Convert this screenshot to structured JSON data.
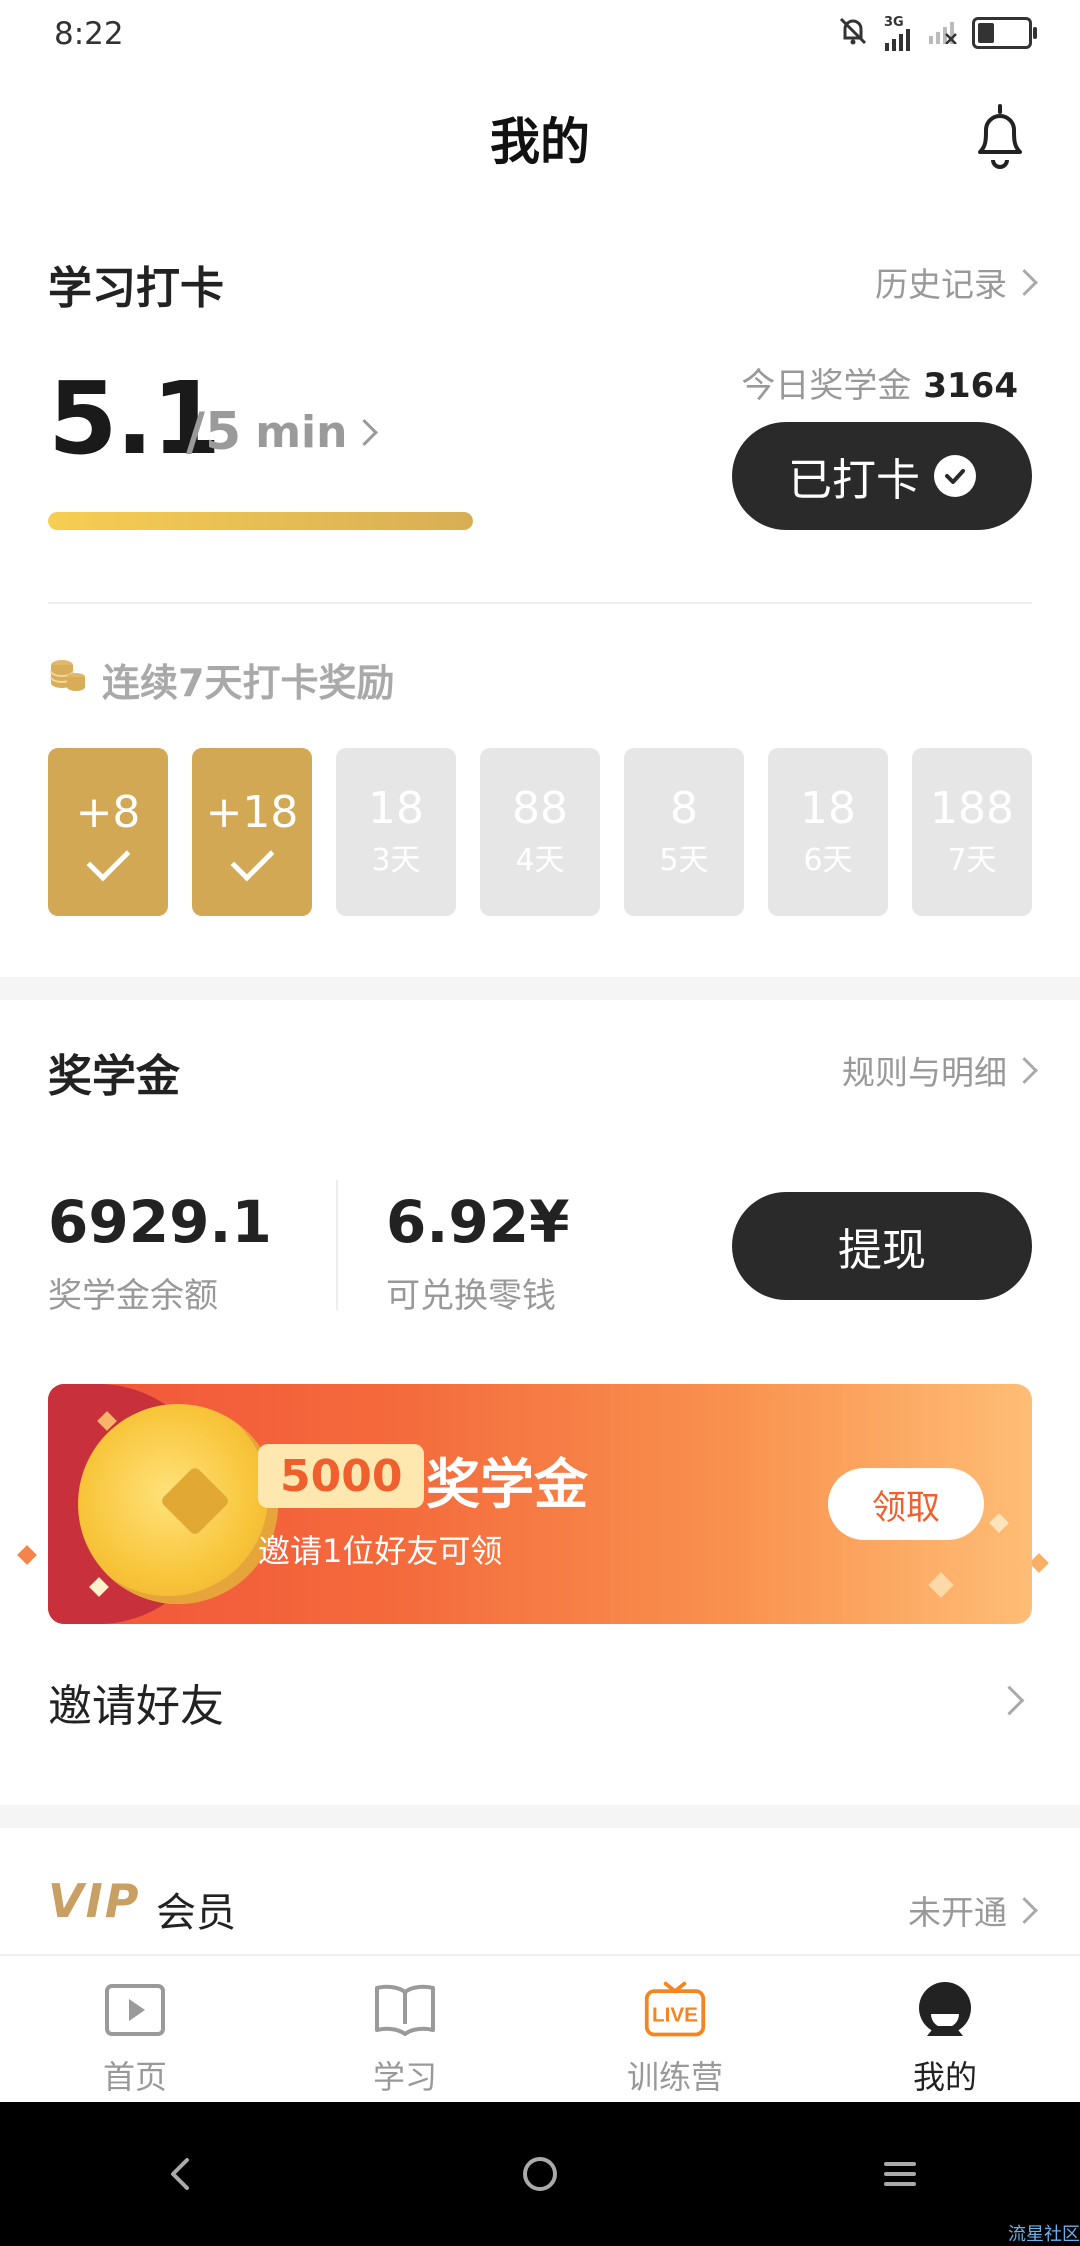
{
  "status_bar": {
    "time": "8:22",
    "network": "3G"
  },
  "header": {
    "title": "我的"
  },
  "checkin": {
    "title": "学习打卡",
    "history_link": "历史记录",
    "minutes_done": "5.1",
    "minutes_goal": "/5",
    "unit": "min",
    "progress_fraction": 1.0,
    "today_label": "今日奖学金",
    "today_value": "3164",
    "checked_label": "已打卡",
    "streak_title": "连续7天打卡奖励",
    "days": [
      {
        "value": "+8",
        "sub": "",
        "done": true
      },
      {
        "value": "+18",
        "sub": "",
        "done": true
      },
      {
        "value": "18",
        "sub": "3天",
        "done": false
      },
      {
        "value": "88",
        "sub": "4天",
        "done": false
      },
      {
        "value": "8",
        "sub": "5天",
        "done": false
      },
      {
        "value": "18",
        "sub": "6天",
        "done": false
      },
      {
        "value": "188",
        "sub": "7天",
        "done": false
      }
    ]
  },
  "scholarship": {
    "title": "奖学金",
    "rules_link": "规则与明细",
    "balance_value": "6929.1",
    "balance_label": "奖学金余额",
    "change_value": "6.92¥",
    "change_label": "可兑换零钱",
    "withdraw_label": "提现",
    "banner": {
      "amount": "5000",
      "word": "奖学金",
      "subtitle": "邀请1位好友可领",
      "claim_label": "领取"
    },
    "invite_label": "邀请好友"
  },
  "vip": {
    "logo": "VIP",
    "label": "会员",
    "status": "未开通"
  },
  "tabbar": {
    "items": [
      {
        "label": "首页",
        "icon": "play-icon"
      },
      {
        "label": "学习",
        "icon": "book-icon"
      },
      {
        "label": "训练营",
        "icon": "live-icon"
      },
      {
        "label": "我的",
        "icon": "profile-icon"
      }
    ]
  },
  "watermark": "流星社区",
  "colors": {
    "gold": "#d2a854",
    "dark": "#2a2a2a",
    "orange": "#f0602f",
    "live": "#f5861f"
  }
}
